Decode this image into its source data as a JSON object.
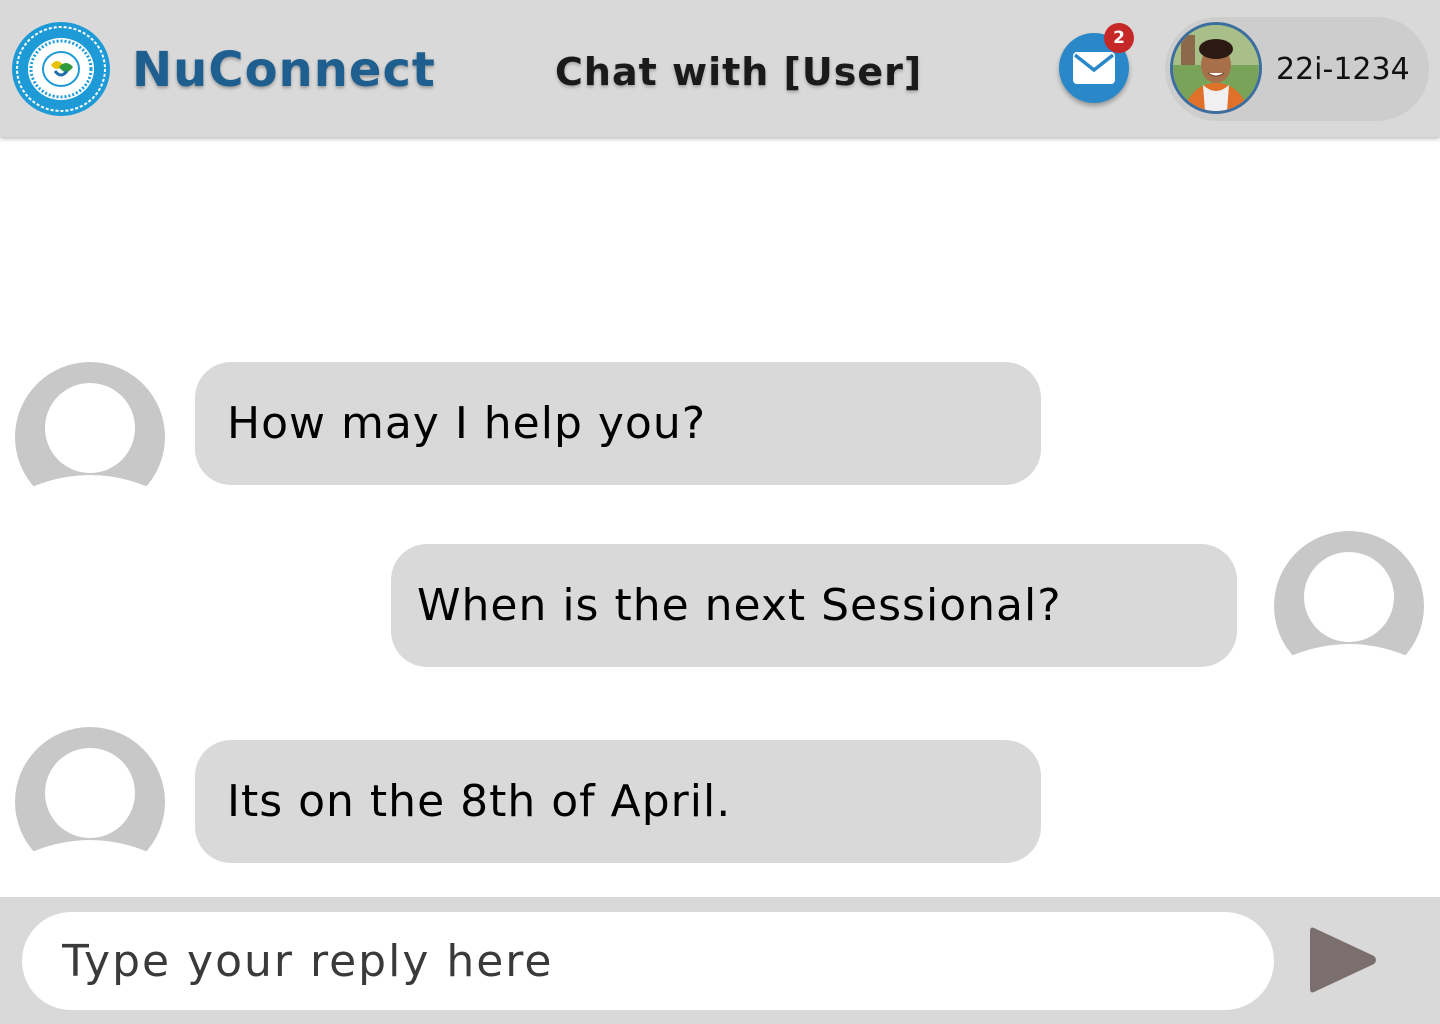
{
  "header": {
    "brand": "NuConnect",
    "chat_title": "Chat with [User]",
    "mail_badge_count": "2",
    "student_id": "22i-1234"
  },
  "messages": [
    {
      "sender": "other",
      "text": "How may I help you?"
    },
    {
      "sender": "self",
      "text": "When is the next Sessional?"
    },
    {
      "sender": "other",
      "text": "Its on the 8th of April."
    }
  ],
  "composer": {
    "placeholder": "Type your reply here"
  },
  "colors": {
    "header_bg": "#d9d9d9",
    "brand": "#1f5f8f",
    "mail_button": "#2b88c8",
    "badge": "#c62828",
    "bubble": "#d9d9d9",
    "send_icon": "#7b6e6e"
  },
  "icons": {
    "logo": "university-seal-logo",
    "mail": "mail-icon",
    "send": "send-icon",
    "avatar": "user-avatar-icon"
  }
}
